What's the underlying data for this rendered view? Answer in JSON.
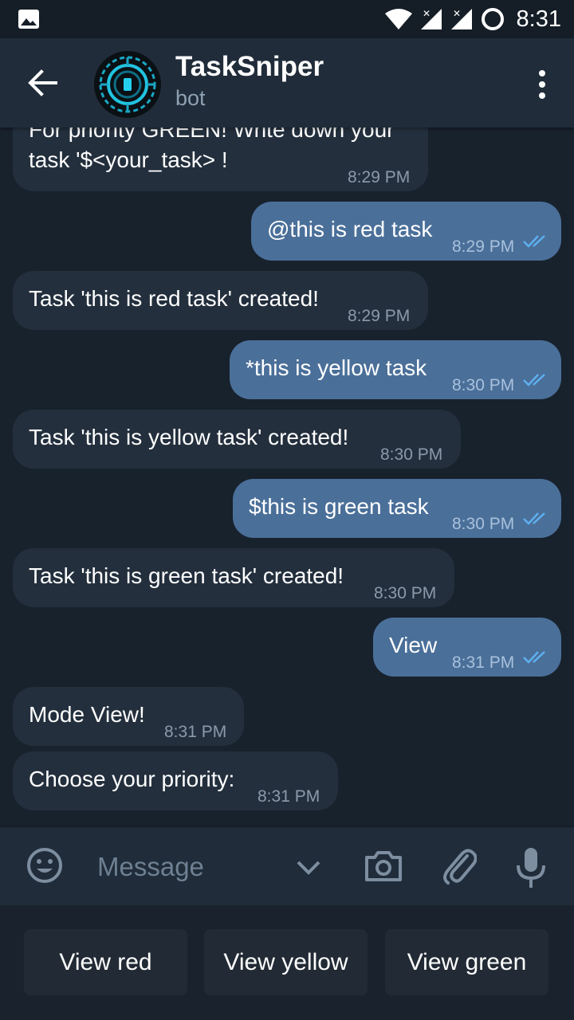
{
  "status_bar": {
    "time": "8:31"
  },
  "header": {
    "title": "TaskSniper",
    "subtitle": "bot"
  },
  "messages": [
    {
      "direction": "in",
      "lines": [
        "For priority GREEN! Write down your",
        "task '$<your_task> !"
      ],
      "time": "8:29 PM"
    },
    {
      "direction": "out",
      "text": "@this is red task",
      "time": "8:29 PM",
      "read": true
    },
    {
      "direction": "in",
      "text": "Task 'this is red task' created!",
      "time": "8:29 PM"
    },
    {
      "direction": "out",
      "text": "*this is yellow task",
      "time": "8:30 PM",
      "read": true
    },
    {
      "direction": "in",
      "text": "Task 'this is yellow task' created!",
      "time": "8:30 PM"
    },
    {
      "direction": "out",
      "text": "$this is green task",
      "time": "8:30 PM",
      "read": true
    },
    {
      "direction": "in",
      "text": "Task 'this is green task' created!",
      "time": "8:30 PM"
    },
    {
      "direction": "out",
      "text": "View",
      "time": "8:31 PM",
      "read": true
    },
    {
      "direction": "in",
      "text": "Mode View!",
      "time": "8:31 PM"
    },
    {
      "direction": "in",
      "text": "Choose your priority:",
      "time": "8:31 PM"
    }
  ],
  "input": {
    "placeholder": "Message"
  },
  "keyboard": {
    "buttons": [
      "View red",
      "View yellow",
      "View green"
    ]
  },
  "colors": {
    "background": "#18222d",
    "header": "#202c39",
    "incoming_bubble": "#232f3d",
    "outgoing_bubble": "#4a6f99",
    "read_check": "#5fb0f0"
  },
  "icons": [
    "gallery-icon",
    "wifi-icon",
    "signal-icon",
    "battery-icon",
    "back-arrow-icon",
    "bot-avatar",
    "more-vert-icon",
    "emoji-icon",
    "chevron-down-icon",
    "camera-icon",
    "attach-icon",
    "mic-icon",
    "double-check-icon"
  ]
}
